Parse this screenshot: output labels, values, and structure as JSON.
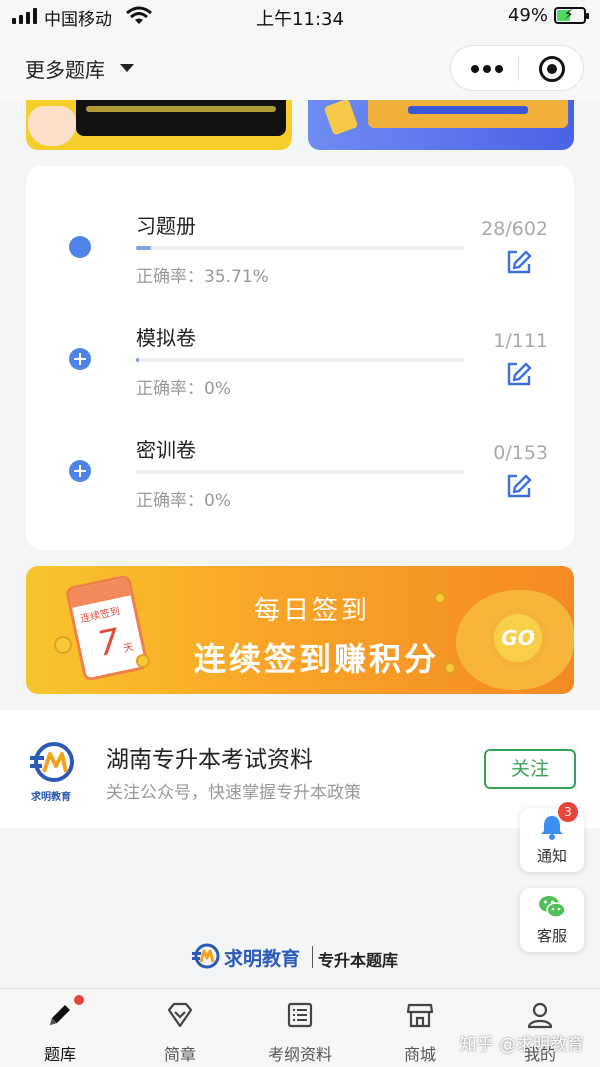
{
  "status_bar": {
    "carrier": "中国移动",
    "time": "上午11:34",
    "battery": "49%",
    "battery_level": 0.49
  },
  "header": {
    "library_selector": "更多题库"
  },
  "practice": {
    "rows": [
      {
        "title": "习题册",
        "accuracy": "正确率：35.71%",
        "count": "28/602",
        "progress": 0.0465,
        "started": true
      },
      {
        "title": "模拟卷",
        "accuracy": "正确率：0%",
        "count": "1/111",
        "progress": 0.009,
        "started": false
      },
      {
        "title": "密训卷",
        "accuracy": "正确率：0%",
        "count": "0/153",
        "progress": 0.0,
        "started": false
      }
    ]
  },
  "signin_banner": {
    "title": "每日签到",
    "subtitle": "连续签到赚积分",
    "calendar_label": "连续签到",
    "calendar_day": "7",
    "calendar_unit": "天",
    "go": "GO"
  },
  "follow": {
    "logo_text": "求明教育",
    "title": "湖南专升本考试资料",
    "description": "关注公众号，快速掌握专升本政策",
    "button": "关注"
  },
  "floating": {
    "notify_label": "通知",
    "notify_count": "3",
    "service_label": "客服"
  },
  "brand": {
    "name": "求明教育",
    "subtitle": "专升本题库"
  },
  "tabs": [
    {
      "label": "题库",
      "icon": "pencil-icon",
      "active": true
    },
    {
      "label": "简章",
      "icon": "diamond-icon",
      "active": false
    },
    {
      "label": "考纲资料",
      "icon": "document-list-icon",
      "active": false
    },
    {
      "label": "商城",
      "icon": "store-icon",
      "active": false
    },
    {
      "label": "我的",
      "icon": "user-icon",
      "active": false
    }
  ],
  "watermark": "知乎 @求明教育",
  "colors": {
    "accent_blue": "#4f83e8",
    "follow_green": "#3aa35a",
    "badge_red": "#e8443a",
    "banner_orange": "#f8a527"
  }
}
